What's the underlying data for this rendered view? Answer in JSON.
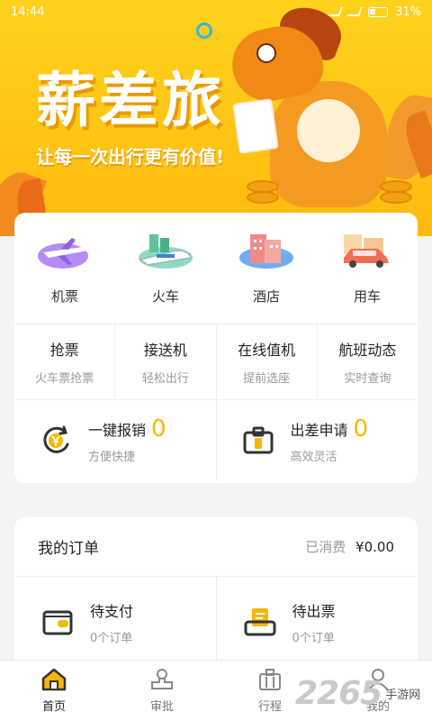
{
  "status_bar": {
    "time": "14:44",
    "battery": "31%"
  },
  "banner": {
    "title": "薪差旅",
    "subtitle": "让每一次出行更有价值!"
  },
  "services": [
    {
      "label": "机票",
      "icon": "airplane-icon"
    },
    {
      "label": "火车",
      "icon": "train-icon"
    },
    {
      "label": "酒店",
      "icon": "hotel-icon"
    },
    {
      "label": "用车",
      "icon": "car-icon"
    }
  ],
  "features": [
    {
      "title": "抢票",
      "sub": "火车票抢票"
    },
    {
      "title": "接送机",
      "sub": "轻松出行"
    },
    {
      "title": "在线值机",
      "sub": "提前选座"
    },
    {
      "title": "航班动态",
      "sub": "实时查询"
    }
  ],
  "quick": [
    {
      "title": "一键报销",
      "count": "0",
      "sub": "方便快捷",
      "icon": "yen-refresh-icon"
    },
    {
      "title": "出差申请",
      "count": "0",
      "sub": "高效灵活",
      "icon": "briefcase-icon"
    }
  ],
  "orders": {
    "title": "我的订单",
    "spent_label": "已消费",
    "spent_value": "¥0.00",
    "items": [
      {
        "title": "待支付",
        "sub": "0个订单",
        "icon": "wallet-icon"
      },
      {
        "title": "待出票",
        "sub": "0个订单",
        "icon": "ticket-printer-icon"
      }
    ]
  },
  "nav": [
    {
      "label": "首页",
      "icon": "home-icon",
      "active": true
    },
    {
      "label": "审批",
      "icon": "approval-stamp-icon",
      "active": false
    },
    {
      "label": "行程",
      "icon": "itinerary-bag-icon",
      "active": false
    },
    {
      "label": "我的",
      "icon": "profile-icon",
      "active": false
    }
  ],
  "watermark": {
    "number": "2265",
    "site": "手游网"
  },
  "colors": {
    "accent": "#f5b800",
    "banner": "#ffc414",
    "brand_orange": "#f59a21"
  }
}
